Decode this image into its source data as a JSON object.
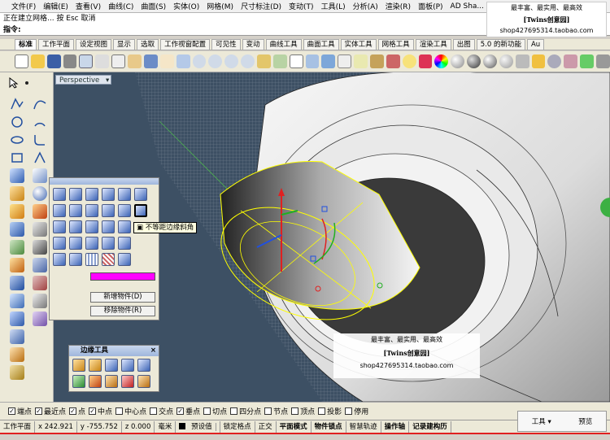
{
  "menu": [
    "文件(F)",
    "编辑(E)",
    "查看(V)",
    "曲线(C)",
    "曲面(S)",
    "实体(O)",
    "网格(M)",
    "尺寸标注(D)",
    "变动(T)",
    "工具(L)",
    "分析(A)",
    "渲染(R)",
    "面板(P)",
    "AD Sha..."
  ],
  "command": {
    "line1": "正在建立网格... 按 Esc 取消",
    "line2": "指令:"
  },
  "watermark": {
    "slogan": "最丰富、最实用、最高效",
    "brand": "[Twins创意园]",
    "shop": "shop427695314.taobao.com"
  },
  "tabs": [
    "标准",
    "工作平面",
    "设定视图",
    "显示",
    "选取",
    "工作视窗配置",
    "可见性",
    "变动",
    "曲线工具",
    "曲面工具",
    "实体工具",
    "网格工具",
    "渲染工具",
    "出图",
    "5.0 的新功能",
    "Au"
  ],
  "viewport": {
    "name": "Perspective",
    "arrow": "▾"
  },
  "solid_panel": {
    "tooltip": "不等距边缘斜角",
    "add_btn": "新增物件(D)",
    "remove_btn": "移除物件(R)",
    "color": "#ff00ff"
  },
  "edge_panel": {
    "title": "边缘工具"
  },
  "osnap": [
    {
      "label": "端点",
      "checked": true
    },
    {
      "label": "最近点",
      "checked": true
    },
    {
      "label": "点",
      "checked": true
    },
    {
      "label": "中点",
      "checked": true
    },
    {
      "label": "中心点",
      "checked": false
    },
    {
      "label": "交点",
      "checked": false
    },
    {
      "label": "垂点",
      "checked": true
    },
    {
      "label": "切点",
      "checked": false
    },
    {
      "label": "四分点",
      "checked": false
    },
    {
      "label": "节点",
      "checked": false
    },
    {
      "label": "顶点",
      "checked": false
    },
    {
      "label": "投影",
      "checked": false
    },
    {
      "label": "停用",
      "checked": false
    }
  ],
  "status": {
    "cplane": "工作平面",
    "x": "x 242.921",
    "y": "y -755.752",
    "z": "z 0.000",
    "unit": "毫米",
    "layer": "预设值",
    "items": [
      "锁定格点",
      "正交",
      "平面模式",
      "物件锁点",
      "智慧轨迹",
      "操作轴",
      "记录建构历"
    ]
  },
  "win_controls": {
    "tools": "工具",
    "arrow": "▾",
    "preview": "预览"
  },
  "colors": {
    "viewport_bg": "#3d5064",
    "accent_red": "#e02020",
    "selection": "#ffff00"
  }
}
